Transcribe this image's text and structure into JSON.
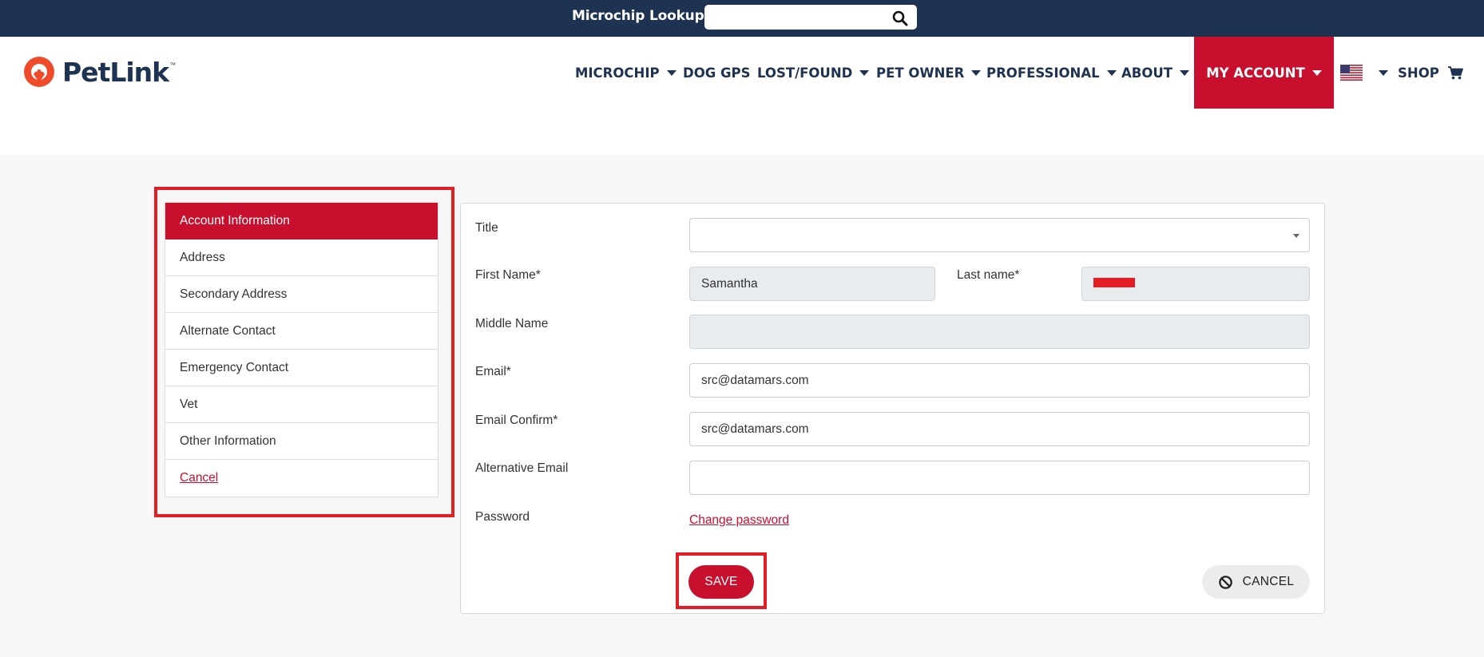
{
  "topbar": {
    "lookup_label": "Microchip Lookup",
    "lookup_placeholder": "",
    "search_icon": "search-icon"
  },
  "brand": {
    "name": "PetLink",
    "tm": "™",
    "primary_color": "#c8102e",
    "navy_color": "#1e3251",
    "logo_color": "#ef4b2b"
  },
  "nav": {
    "items": [
      {
        "label": "MICROCHIP",
        "dropdown": true
      },
      {
        "label": "DOG GPS",
        "dropdown": false
      },
      {
        "label": "LOST/FOUND",
        "dropdown": true
      },
      {
        "label": "PET OWNER",
        "dropdown": true
      },
      {
        "label": "PROFESSIONAL",
        "dropdown": true
      },
      {
        "label": "ABOUT",
        "dropdown": true
      },
      {
        "label": "MY ACCOUNT",
        "dropdown": true,
        "active": true
      }
    ],
    "language_icon": "us-flag-icon",
    "shop_label": "SHOP",
    "cart_icon": "cart-icon"
  },
  "sidebar": {
    "items": [
      {
        "label": "Account Information",
        "active": true
      },
      {
        "label": "Address"
      },
      {
        "label": "Secondary Address"
      },
      {
        "label": "Alternate Contact"
      },
      {
        "label": "Emergency Contact"
      },
      {
        "label": "Vet"
      },
      {
        "label": "Other Information"
      },
      {
        "label": "Cancel",
        "link": true
      }
    ]
  },
  "form": {
    "title_label": "Title",
    "title_value": "",
    "first_name_label": "First Name*",
    "first_name_value": "Samantha",
    "last_name_label": "Last name*",
    "last_name_value": "",
    "middle_name_label": "Middle Name",
    "middle_name_value": "",
    "email_label": "Email*",
    "email_value": "src@datamars.com",
    "email_confirm_label": "Email Confirm*",
    "email_confirm_value": "src@datamars.com",
    "alt_email_label": "Alternative Email",
    "alt_email_value": "",
    "password_label": "Password",
    "change_password_link": "Change password",
    "save_label": "SAVE",
    "cancel_label": "CANCEL",
    "cancel_icon": "ban-icon"
  }
}
